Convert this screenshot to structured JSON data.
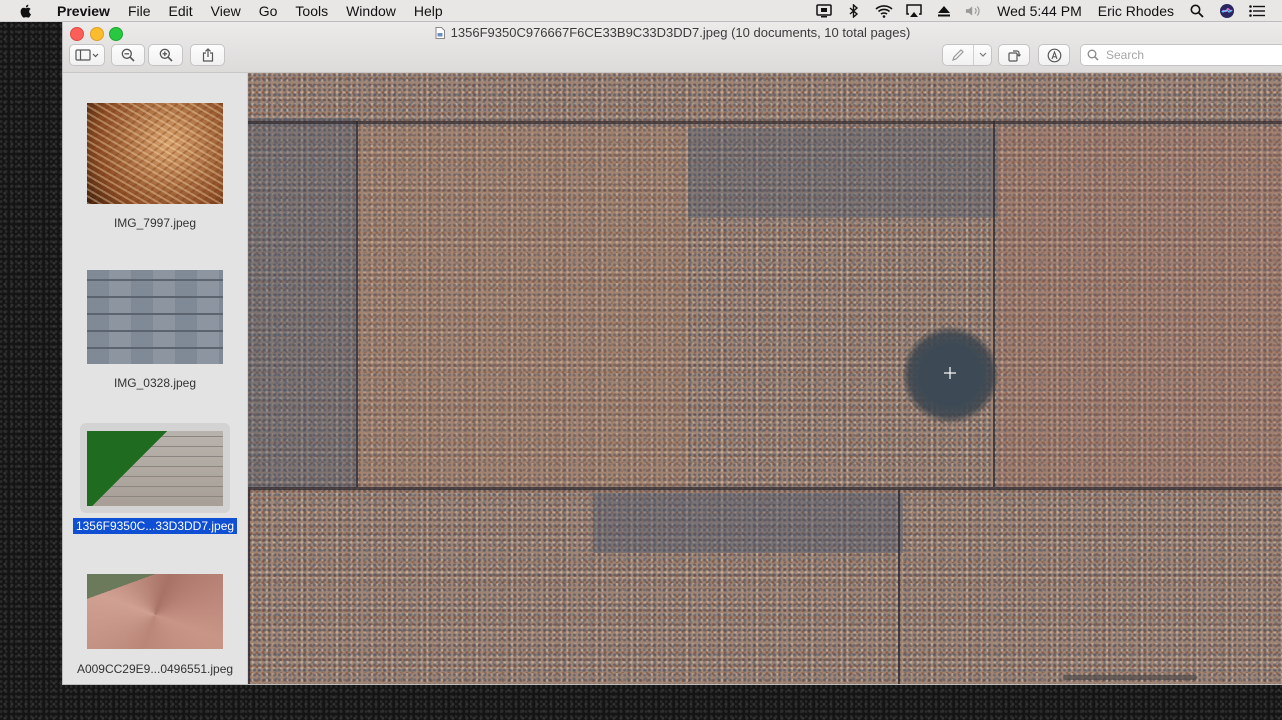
{
  "menubar": {
    "app_name": "Preview",
    "items": [
      "File",
      "Edit",
      "View",
      "Go",
      "Tools",
      "Window",
      "Help"
    ],
    "clock": "Wed 5:44 PM",
    "user": "Eric Rhodes"
  },
  "window": {
    "title": "1356F9350C976667F6CE33B9C33D3DD7.jpeg (10 documents, 10 total pages)"
  },
  "toolbar": {
    "search_placeholder": "Search"
  },
  "sidebar": {
    "items": [
      {
        "label": "IMG_7997.jpeg",
        "selected": false
      },
      {
        "label": "IMG_0328.jpeg",
        "selected": false
      },
      {
        "label": "1356F9350C...33D3DD7.jpeg",
        "selected": true
      },
      {
        "label": "A009CC29E9...0496551.jpeg",
        "selected": false
      }
    ]
  },
  "colors": {
    "selection": "#0f4fd3",
    "close": "#fc5f57",
    "minimize": "#fdbc2e",
    "zoom": "#28c840"
  }
}
